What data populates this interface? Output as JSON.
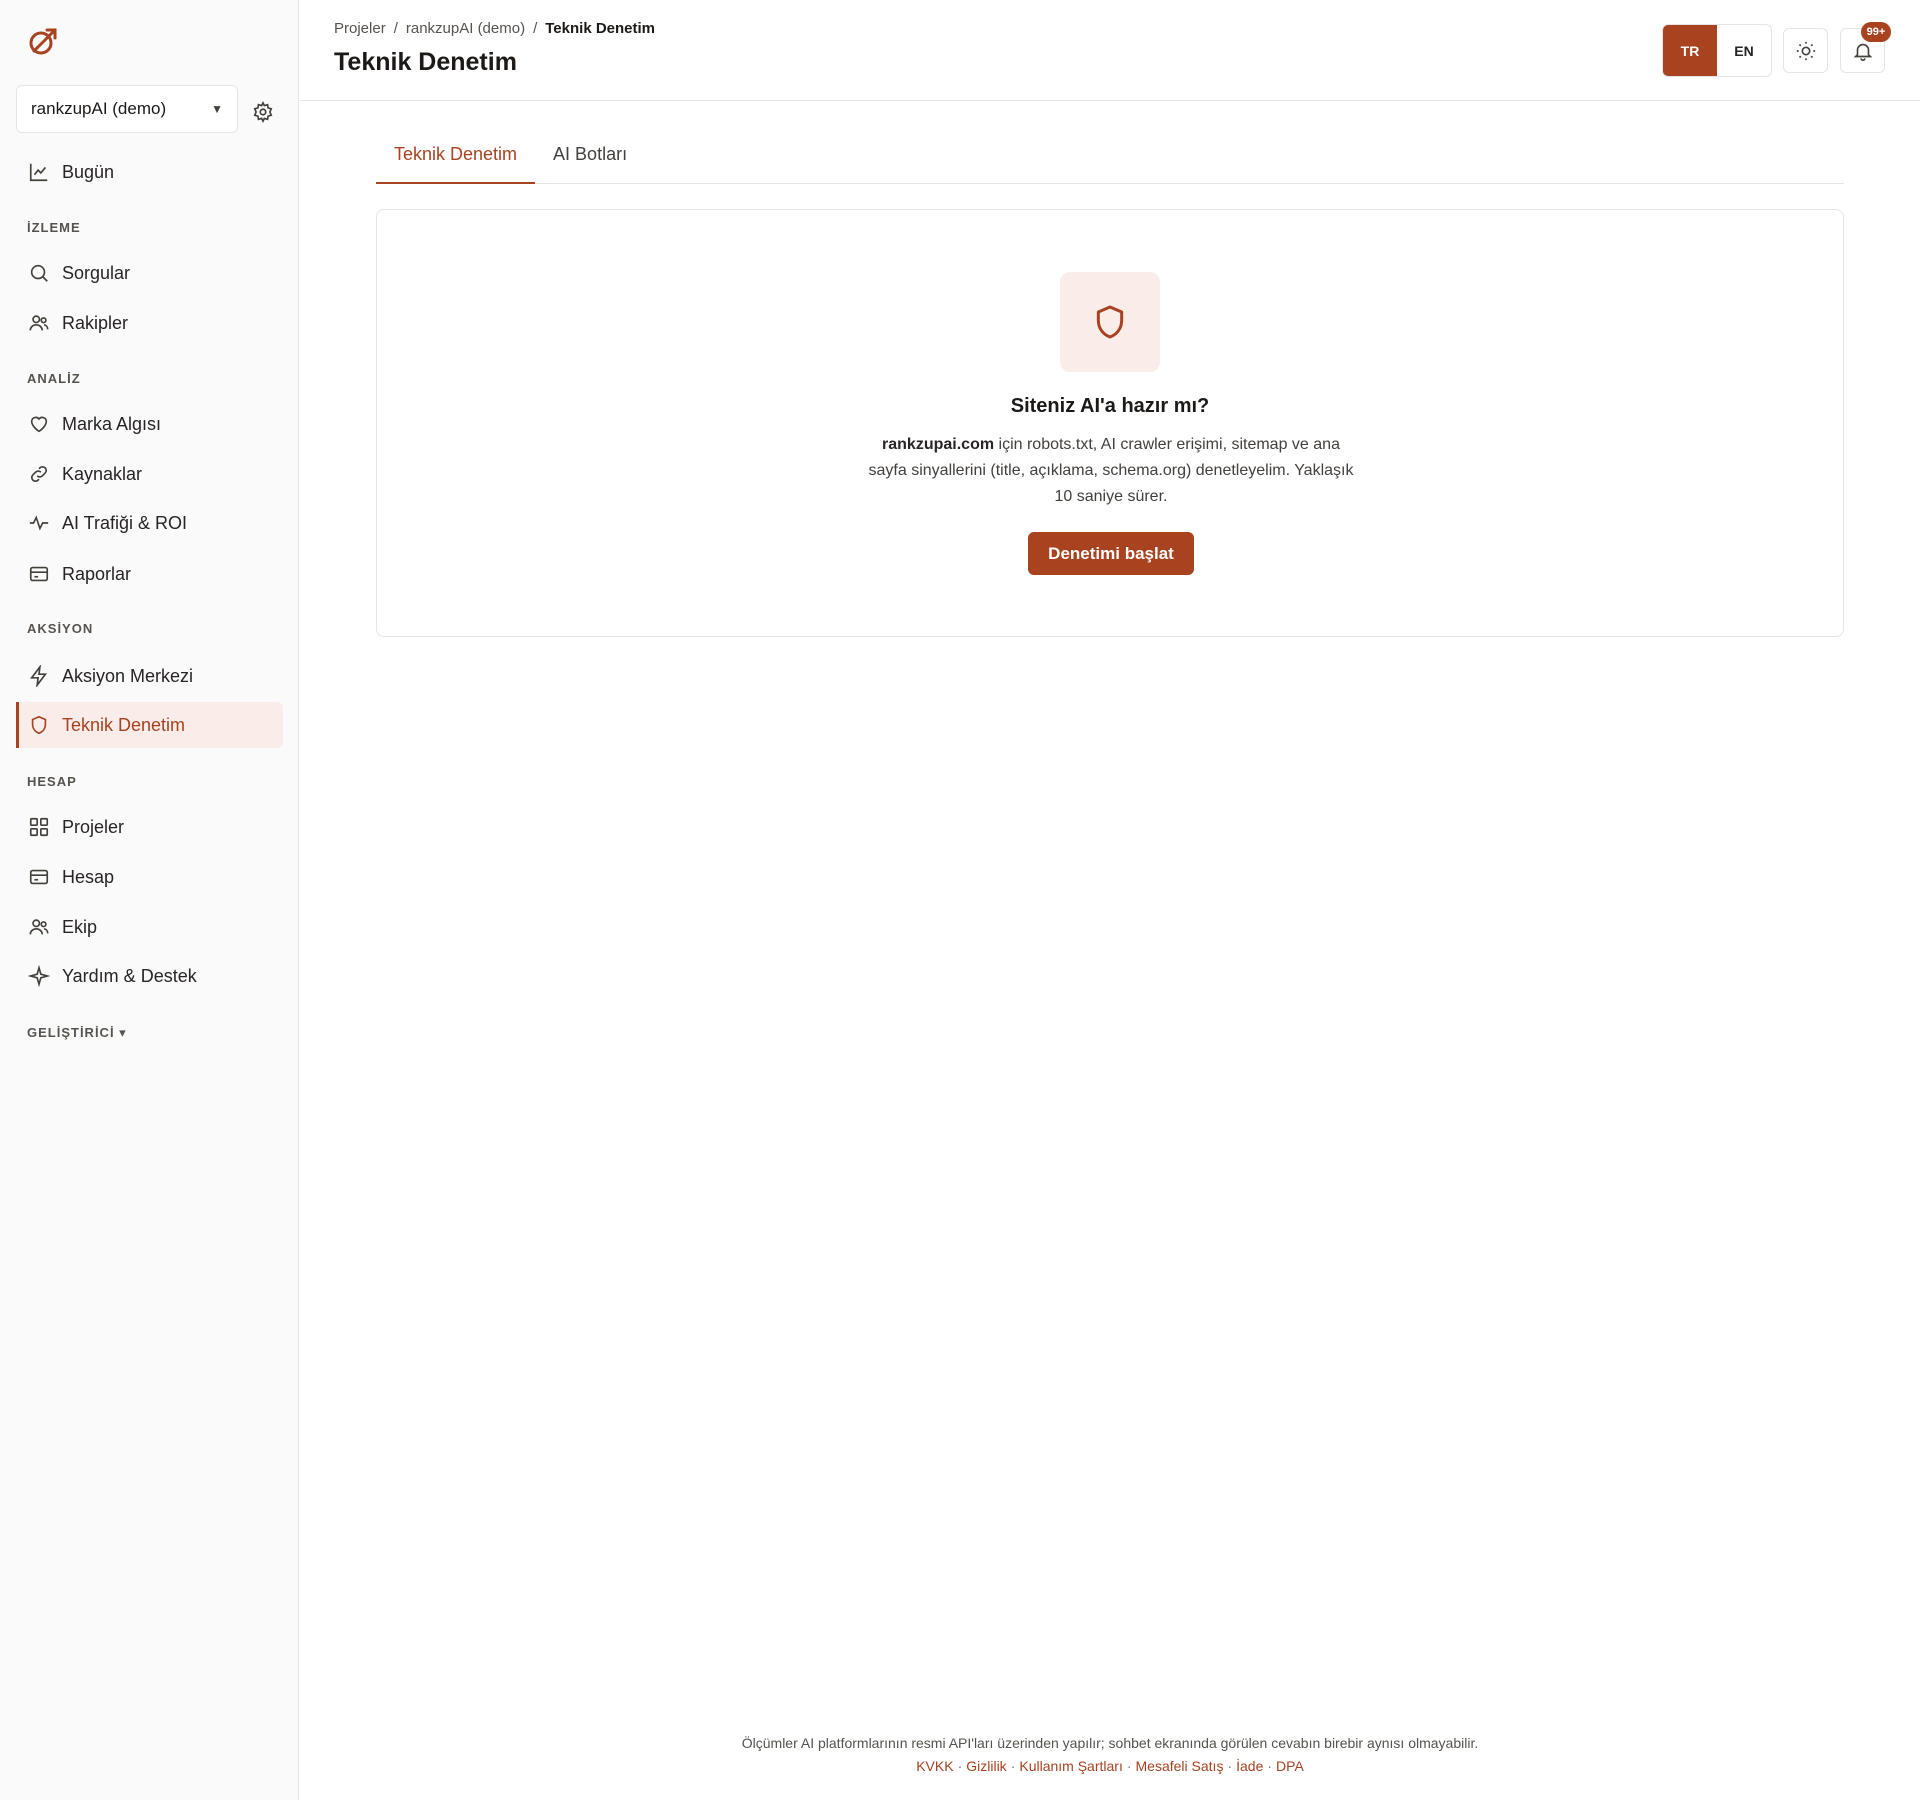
{
  "sidebar": {
    "project_name": "rankzupAI (demo)",
    "sections": {
      "izleme": "İZLEME",
      "analiz": "ANALİZ",
      "aksiyon": "AKSİYON",
      "hesap": "HESAP",
      "gelistirici": "GELİŞTİRİCİ ▾"
    },
    "items": {
      "bugun": "Bugün",
      "sorgular": "Sorgular",
      "rakipler": "Rakipler",
      "marka": "Marka Algısı",
      "kaynaklar": "Kaynaklar",
      "ai_trafigi": "AI Trafiği & ROI",
      "raporlar": "Raporlar",
      "aksiyon_merkezi": "Aksiyon Merkezi",
      "teknik_denetim": "Teknik Denetim",
      "projeler": "Projeler",
      "hesap": "Hesap",
      "ekip": "Ekip",
      "yardim": "Yardım & Destek"
    }
  },
  "header": {
    "breadcrumb": [
      "Projeler",
      "/",
      "rankzupAI (demo)",
      "/",
      "Teknik Denetim"
    ],
    "title": "Teknik Denetim",
    "lang_tr": "TR",
    "lang_en": "EN",
    "notifications_badge": "99+"
  },
  "tabs": [
    "Teknik Denetim",
    "AI Botları"
  ],
  "card": {
    "title": "Siteniz AI'a hazır mı?",
    "domain": "rankzupai.com",
    "desc_rest": " için robots.txt, AI crawler erişimi, sitemap ve ana sayfa sinyallerini (title, açıklama, schema.org) denetleyelim. Yaklaşık 10 saniye sürer.",
    "button": "Denetimi başlat"
  },
  "footer": {
    "note": "Ölçümler AI platformlarının resmi API'ları üzerinden yapılır; sohbet ekranında görülen cevabın birebir aynısı olmayabilir.",
    "links": [
      "KVKK",
      "Gizlilik",
      "Kullanım Şartları",
      "Mesafeli Satış",
      "İade",
      "DPA"
    ]
  },
  "colors": {
    "accent": "#a8421f",
    "accent_soft": "#f9ece9"
  }
}
